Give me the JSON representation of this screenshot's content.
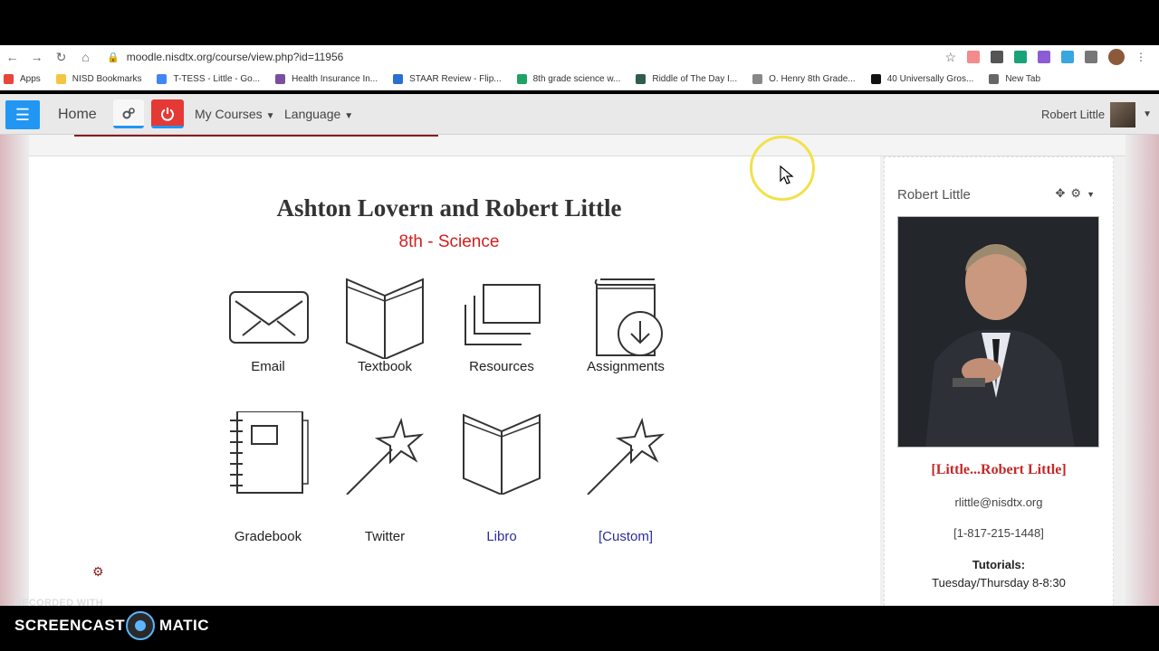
{
  "browser": {
    "url": "moodle.nisdtx.org/course/view.php?id=11956",
    "bookmarks": [
      {
        "label": "Apps",
        "color": "#e8453c"
      },
      {
        "label": "NISD Bookmarks",
        "color": "#f5c542"
      },
      {
        "label": "T-TESS - Little - Go...",
        "color": "#4285f4"
      },
      {
        "label": "Health Insurance In...",
        "color": "#7a4fa0"
      },
      {
        "label": "STAAR Review - Flip...",
        "color": "#2a6fd1"
      },
      {
        "label": "8th grade science w...",
        "color": "#1ea362"
      },
      {
        "label": "Riddle of The Day I...",
        "color": "#2e5d4a"
      },
      {
        "label": "O. Henry 8th Grade...",
        "color": "#888888"
      },
      {
        "label": "40 Universally Gros...",
        "color": "#111111"
      },
      {
        "label": "New Tab",
        "color": "#666666"
      }
    ]
  },
  "navbar": {
    "home": "Home",
    "my_courses": "My Courses",
    "language": "Language",
    "user": "Robert Little"
  },
  "course": {
    "teacher": "Ashton Lovern and Robert Little",
    "subject": "8th - Science",
    "tiles": [
      {
        "label": "Email",
        "icon": "envelope-icon"
      },
      {
        "label": "Textbook",
        "icon": "book-icon"
      },
      {
        "label": "Resources",
        "icon": "stacked-pages-icon"
      },
      {
        "label": "Assignments",
        "icon": "book-download-icon"
      },
      {
        "label": "Gradebook",
        "icon": "notebook-icon"
      },
      {
        "label": "Twitter",
        "icon": "magic-wand-icon"
      },
      {
        "label": "Libro",
        "icon": "book-icon"
      },
      {
        "label": "[Custom]",
        "icon": "magic-wand-icon"
      }
    ]
  },
  "block": {
    "title": "Robert Little",
    "name": "[Little...Robert Little]",
    "email": "rlittle@nisdtx.org",
    "phone": "[1-817-215-1448]",
    "tutorials_label": "Tutorials:",
    "tutorials_time": "Tuesday/Thursday 8-8:30"
  },
  "recorder": {
    "recorded_with": "RECORDED WITH",
    "brand_left": "SCREENCAST",
    "brand_right": "MATIC"
  }
}
